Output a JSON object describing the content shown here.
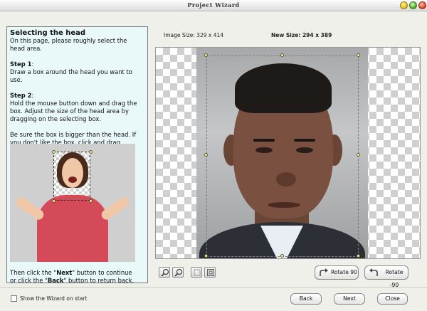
{
  "window": {
    "title": "Project Wizard"
  },
  "help": {
    "heading": "Selecting the head",
    "intro": "On this page, please roughly select the head area.",
    "step1_title": "Step 1",
    "step1_text": "Draw a box around the head you want to use.",
    "step2_title": "Step 2",
    "step2_text": "Hold the mouse button down and drag the box. Adjust the size of the head area by dragging on the selecting box.",
    "tip": "Be sure the box is bigger than the head. If you don't like the box, click and drag again.",
    "footer_pre": "Then click the \"",
    "footer_next": "Next",
    "footer_mid": "\" button to continue or click the \"",
    "footer_back": "Back",
    "footer_post": "\" button to return back."
  },
  "sizes": {
    "image_size": "Image Size: 329 x 414",
    "new_size": "New Size: 294 x 389"
  },
  "toolbar": {
    "rotate_cw": "Rotate 90",
    "rotate_ccw": "Rotate -90"
  },
  "footer": {
    "show_wizard": "Show the Wizard on start",
    "show_wizard_checked": false,
    "back": "Back",
    "next": "Next",
    "close": "Close"
  }
}
